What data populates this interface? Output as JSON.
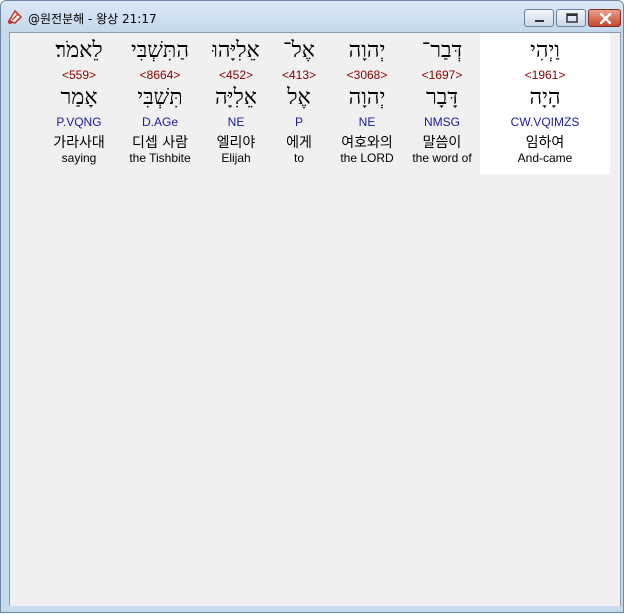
{
  "window": {
    "title": "@원전분해 - 왕상 21:17"
  },
  "words": [
    {
      "hebrew": "וַיְהִי",
      "strong": "<1961>",
      "lemma": "הָיָה",
      "morph": "CW.VQIMZS",
      "korean": "임하여",
      "english": "And-came"
    },
    {
      "hebrew": "דְּבַר־",
      "strong": "<1697>",
      "lemma": "דָּבָר",
      "morph": "NMSG",
      "korean": "말씀이",
      "english": "the word of"
    },
    {
      "hebrew": "יְהוָה",
      "strong": "<3068>",
      "lemma": "יְהוָה",
      "morph": "NE",
      "korean": "여호와의",
      "english": "the LORD"
    },
    {
      "hebrew": "אֶל־",
      "strong": "<413>",
      "lemma": "אֶל",
      "morph": "P",
      "korean": "에게",
      "english": "to"
    },
    {
      "hebrew": "אֵלִיָּהוּ",
      "strong": "<452>",
      "lemma": "אֵלִיָּה",
      "morph": "NE",
      "korean": "엘리야",
      "english": "Elijah"
    },
    {
      "hebrew": "הַתִּשְׁבִּי",
      "strong": "<8664>",
      "lemma": "תִּשְׁבִּי",
      "morph": "D.AGe",
      "korean": "디셉 사람",
      "english": "the Tishbite"
    },
    {
      "hebrew": "לֵאמֹר׃",
      "strong": "<559>",
      "lemma": "אָמַר",
      "morph": "P.VQNG",
      "korean": "가라사대",
      "english": "saying"
    }
  ]
}
